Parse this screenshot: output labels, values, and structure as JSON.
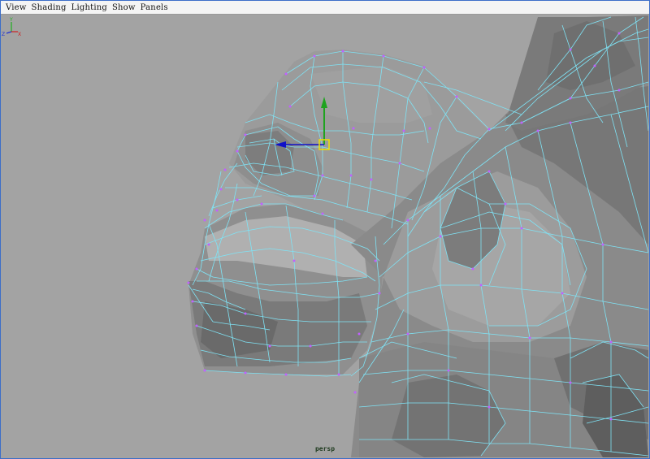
{
  "menubar": {
    "items": [
      "View",
      "Shading",
      "Lighting",
      "Show",
      "Panels"
    ]
  },
  "viewport": {
    "camera": "persp"
  },
  "axis_gizmo": {
    "labels": [
      "Y",
      "Z",
      "X"
    ]
  },
  "colors": {
    "background": "#a3a3a3",
    "wireframe": "#7fe3f5",
    "vertex": "#c060ff",
    "manip_y": "#1fa31f",
    "manip_z": "#1010c8",
    "manip_center": "#f0e000"
  }
}
